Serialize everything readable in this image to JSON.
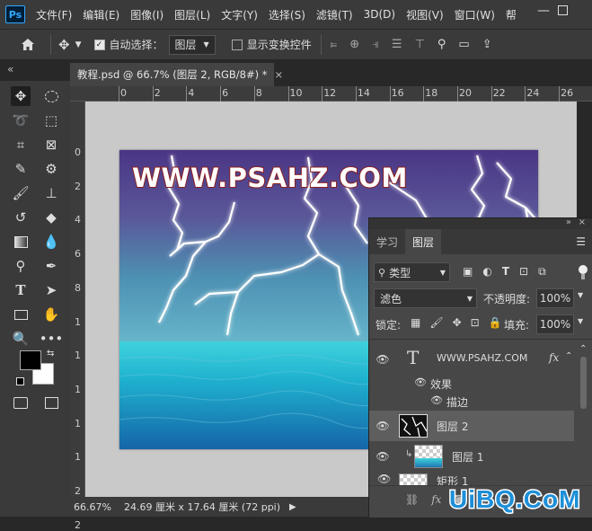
{
  "app": {
    "logo": "Ps"
  },
  "menubar": {
    "items": [
      "文件(F)",
      "编辑(E)",
      "图像(I)",
      "图层(L)",
      "文字(Y)",
      "选择(S)",
      "滤镜(T)",
      "3D(D)",
      "视图(V)",
      "窗口(W)",
      "帮"
    ]
  },
  "options": {
    "auto_select_label": "自动选择：",
    "auto_select_checked": true,
    "target_value": "图层",
    "show_transform_label": "显示变换控件",
    "show_transform_checked": false
  },
  "document": {
    "tab_title": "教程.psd @ 66.7% (图层 2, RGB/8#) *",
    "close_glyph": "×"
  },
  "rulers": {
    "top": [
      "0",
      "2",
      "4",
      "6",
      "8",
      "10",
      "12",
      "14",
      "16",
      "18",
      "20",
      "22",
      "24",
      "26"
    ],
    "left": [
      "0",
      "2",
      "4",
      "6",
      "8",
      "1",
      "1",
      "1",
      "1",
      "1",
      "2",
      "2"
    ]
  },
  "artwork": {
    "watermark": "WWW.PSAHZ.COM"
  },
  "status": {
    "zoom": "66.67%",
    "doc_size": "24.69 厘米 x 17.64 厘米 (72 ppi)"
  },
  "layers_panel": {
    "tabs": [
      "学习",
      "图层"
    ],
    "active_tab": "图层",
    "filter_kind": "类型",
    "blend_mode": "滤色",
    "opacity_label": "不透明度:",
    "opacity_value": "100%",
    "lock_label": "锁定:",
    "fill_label": "填充:",
    "fill_value": "100%",
    "layers": [
      {
        "name": "WWW.PSAHZ.COM",
        "type": "text",
        "fx": "fx"
      },
      {
        "name": "效果",
        "type": "effects-group"
      },
      {
        "name": "描边",
        "type": "effect"
      },
      {
        "name": "图层 2",
        "type": "pixel",
        "selected": true
      },
      {
        "name": "图层 1",
        "type": "pixel",
        "clipped": true
      },
      {
        "name": "矩形 1",
        "type": "shape"
      }
    ],
    "footer_fx": "fx"
  },
  "watermark_corner": "UiBQ.CoM",
  "colors": {
    "ui_bg": "#3a3a3a",
    "dark_bg": "#282828",
    "panel_bg": "#474747",
    "selected_layer": "#5e5e5e",
    "text_outline": "#8b1e1e",
    "sky_top": "#5a3f86",
    "sea": "#27a6c7",
    "ps_blue": "#31a8ff",
    "watermark_blue": "#1e8fd8"
  },
  "icons": [
    "move-icon",
    "marquee-icon",
    "lasso-icon",
    "quick-select-icon",
    "crop-icon",
    "frame-icon",
    "eyedropper-icon",
    "patch-icon",
    "brush-icon",
    "stamp-icon",
    "history-brush-icon",
    "eraser-icon",
    "gradient-icon",
    "blur-icon",
    "dodge-icon",
    "pen-icon",
    "type-icon",
    "path-select-icon",
    "rectangle-icon",
    "hand-icon",
    "zoom-icon",
    "more-icon",
    "eye-icon",
    "link-icon",
    "search-icon"
  ]
}
